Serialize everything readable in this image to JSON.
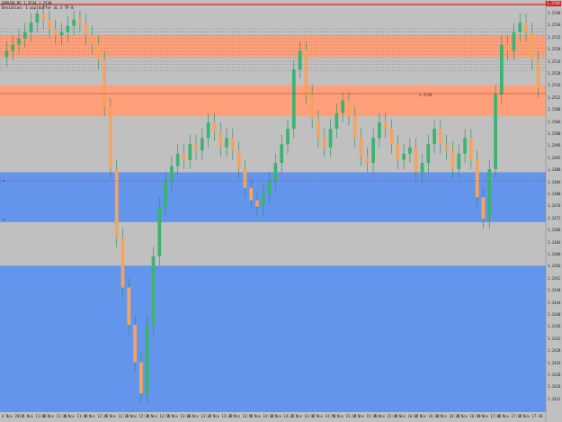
{
  "window": {
    "title_line1": "GBPUSD,M1  1.2534 1.2538",
    "title_line2": "Deviation: 1 pip buffer  SL 3 TP 8"
  },
  "price_tag": "1.2538",
  "y_axis_labels": [
    "1.2540",
    "1.2536",
    "1.2532",
    "1.2528",
    "1.2524",
    "1.2520",
    "1.2516",
    "1.2512",
    "1.2508",
    "1.2504",
    "1.2500",
    "1.2496",
    "1.2492",
    "1.2488",
    "1.2484",
    "1.2480",
    "1.2476",
    "1.2472",
    "1.2468",
    "1.2464",
    "1.2460",
    "1.2456",
    "1.2452",
    "1.2448",
    "1.2444",
    "1.2440",
    "1.2436",
    "1.2432",
    "1.2428",
    "1.2424",
    "1.2420",
    "1.2416",
    "1.2412"
  ],
  "x_axis_labels": [
    "4 Nov 2024",
    "4 Nov 11:06",
    "4 Nov 11:30",
    "4 Nov 11:46",
    "4 Nov 12:02",
    "4 Nov 12:18",
    "4 Nov 12:34",
    "4 Nov 12:50",
    "4 Nov 13:06",
    "4 Nov 13:22",
    "4 Nov 13:38",
    "4 Nov 13:54",
    "4 Nov 14:10",
    "4 Nov 14:26",
    "4 Nov 14:42",
    "4 Nov 14:58",
    "4 Nov 15:14",
    "4 Nov 15:30",
    "4 Nov 15:46",
    "4 Nov 16:02",
    "4 Nov 16:18",
    "4 Nov 16:34",
    "4 Nov 16:50",
    "4 Nov 17:06",
    "4 Nov 17:22",
    "4 Nov 17:38"
  ],
  "markers": {
    "left_upper": "►",
    "left_lower": "►",
    "current_price_label": "1.2538"
  },
  "colors": {
    "background": "#c0c0c0",
    "supply_zone": "#ffa07a",
    "demand_zone": "#6495ed",
    "bull_candle": "#3cb371",
    "bear_candle": "#f4a460",
    "wick": "#2e8b57",
    "top_line": "#d92020"
  },
  "chart_data": {
    "type": "candlestick",
    "title": "",
    "xlabel": "",
    "ylabel": "",
    "ylim": [
      1.2412,
      1.2542
    ],
    "zones": [
      {
        "kind": "supply",
        "from": 1.2526,
        "to": 1.2533
      },
      {
        "kind": "supply",
        "from": 1.2507,
        "to": 1.2517
      },
      {
        "kind": "demand",
        "from": 1.2473,
        "to": 1.2489
      },
      {
        "kind": "demand",
        "from": 1.2412,
        "to": 1.2459
      }
    ],
    "close_series": [
      1.2528,
      1.253,
      1.2532,
      1.2534,
      1.2537,
      1.254,
      1.2538,
      1.2535,
      1.2533,
      1.2534,
      1.2536,
      1.2538,
      1.2537,
      1.2533,
      1.253,
      1.2525,
      1.251,
      1.249,
      1.2468,
      1.2452,
      1.244,
      1.2428,
      1.2418,
      1.244,
      1.2462,
      1.2478,
      1.2486,
      1.2491,
      1.2495,
      1.2493,
      1.2498,
      1.2496,
      1.25,
      1.2505,
      1.2502,
      1.2497,
      1.25,
      1.2496,
      1.249,
      1.2484,
      1.248,
      1.2478,
      1.2482,
      1.2486,
      1.2492,
      1.2498,
      1.2503,
      1.2522,
      1.2528,
      1.2514,
      1.2506,
      1.25,
      1.2497,
      1.2503,
      1.2508,
      1.2512,
      1.2507,
      1.25,
      1.2494,
      1.2492,
      1.25,
      1.2505,
      1.2503,
      1.2498,
      1.2493,
      1.2495,
      1.2497,
      1.2489,
      1.2492,
      1.2498,
      1.2503,
      1.2498,
      1.2496,
      1.249,
      1.2495,
      1.25,
      1.2493,
      1.2481,
      1.2474,
      1.249,
      1.2514,
      1.253,
      1.2528,
      1.2534,
      1.2537,
      1.2534,
      1.2525,
      1.2516
    ]
  }
}
